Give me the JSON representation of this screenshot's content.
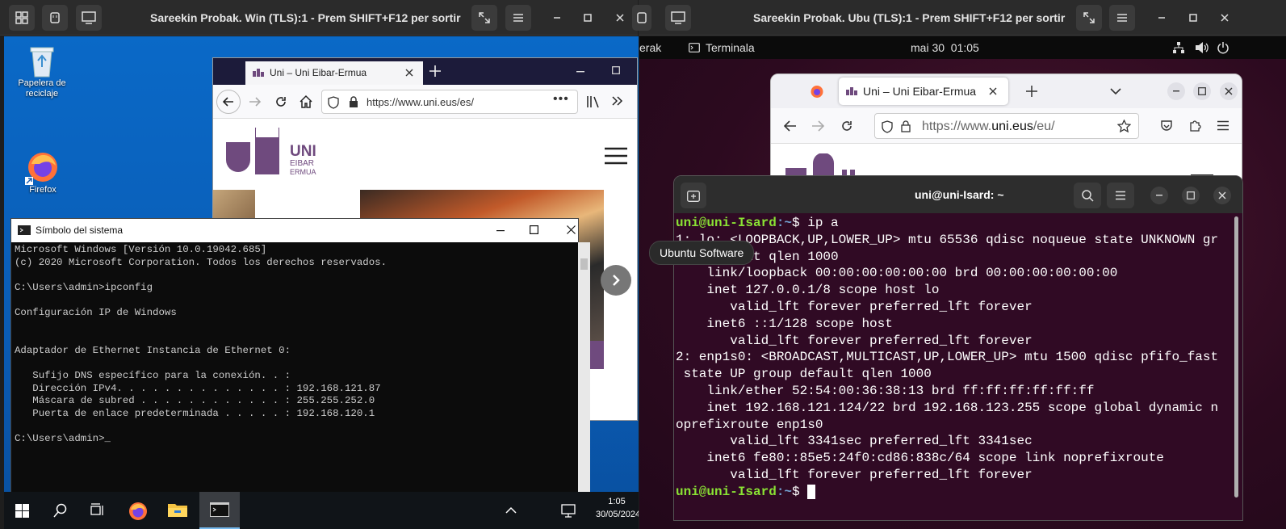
{
  "left_viewer": {
    "title": "Sareekin Probak. Win (TLS):1 - Prem SHIFT+F12 per sortir"
  },
  "right_viewer": {
    "title": "Sareekin Probak. Ubu (TLS):1 - Prem SHIFT+F12 per sortir"
  },
  "win_desktop": {
    "recycle_bin": "Papelera de reciclaje",
    "firefox": "Firefox"
  },
  "win_firefox": {
    "tab_title": "Uni – Uni Eibar-Ermua",
    "url": "https://www.uni.eus/es/",
    "logo_line1": "UNI",
    "logo_line2": "EIBAR",
    "logo_line3": "ERMUA"
  },
  "cmd": {
    "title": "Símbolo del sistema",
    "lines": [
      "Microsoft Windows [Versión 10.0.19042.685]",
      "(c) 2020 Microsoft Corporation. Todos los derechos reservados.",
      "",
      "C:\\Users\\admin>ipconfig",
      "",
      "Configuración IP de Windows",
      "",
      "",
      "Adaptador de Ethernet Instancia de Ethernet 0:",
      "",
      "   Sufijo DNS específico para la conexión. . :",
      "   Dirección IPv4. . . . . . . . . . . . . . : 192.168.121.87",
      "   Máscara de subred . . . . . . . . . . . . : 255.255.252.0",
      "   Puerta de enlace predeterminada . . . . . : 192.168.120.1",
      "",
      "C:\\Users\\admin>"
    ]
  },
  "taskbar": {
    "time": "1:05",
    "date": "30/05/2024"
  },
  "ubuntu_panel": {
    "app_prefix": "erak",
    "app": "Terminala",
    "clock": "mai 30  01:05"
  },
  "ubu_firefox": {
    "tab_title": "Uni – Uni Eibar-Ermua",
    "url": "https://www.uni.eus/eu/",
    "url_host": "uni.eus",
    "url_pre": "https://www.",
    "url_post": "/eu/"
  },
  "terminal": {
    "title": "uni@uni-Isard: ~",
    "prompt_user": "uni@uni-Isard",
    "prompt_path": ":~",
    "prompt_sym": "$ ",
    "cmd": "ip a",
    "lines": [
      "1: lo: <LOOPBACK,UP,LOWER_UP> mtu 65536 qdisc noqueue state UNKNOWN gr",
      "oup default qlen 1000",
      "    link/loopback 00:00:00:00:00:00 brd 00:00:00:00:00:00",
      "    inet 127.0.0.1/8 scope host lo",
      "       valid_lft forever preferred_lft forever",
      "    inet6 ::1/128 scope host",
      "       valid_lft forever preferred_lft forever",
      "2: enp1s0: <BROADCAST,MULTICAST,UP,LOWER_UP> mtu 1500 qdisc pfifo_fast",
      " state UP group default qlen 1000",
      "    link/ether 52:54:00:36:38:13 brd ff:ff:ff:ff:ff:ff",
      "    inet 192.168.121.124/22 brd 192.168.123.255 scope global dynamic n",
      "oprefixroute enp1s0",
      "       valid_lft 3341sec preferred_lft 3341sec",
      "    inet6 fe80::85e5:24f0:cd86:838c/64 scope link noprefixroute",
      "       valid_lft forever preferred_lft forever"
    ]
  },
  "tooltip": "Ubuntu Software",
  "colors": {
    "win_blue": "#0a69c7",
    "ubuntu_bg": "#300a24",
    "prompt_green": "#8ae234",
    "path_blue": "#729fcf",
    "uni_purple": "#6f4a7e"
  }
}
